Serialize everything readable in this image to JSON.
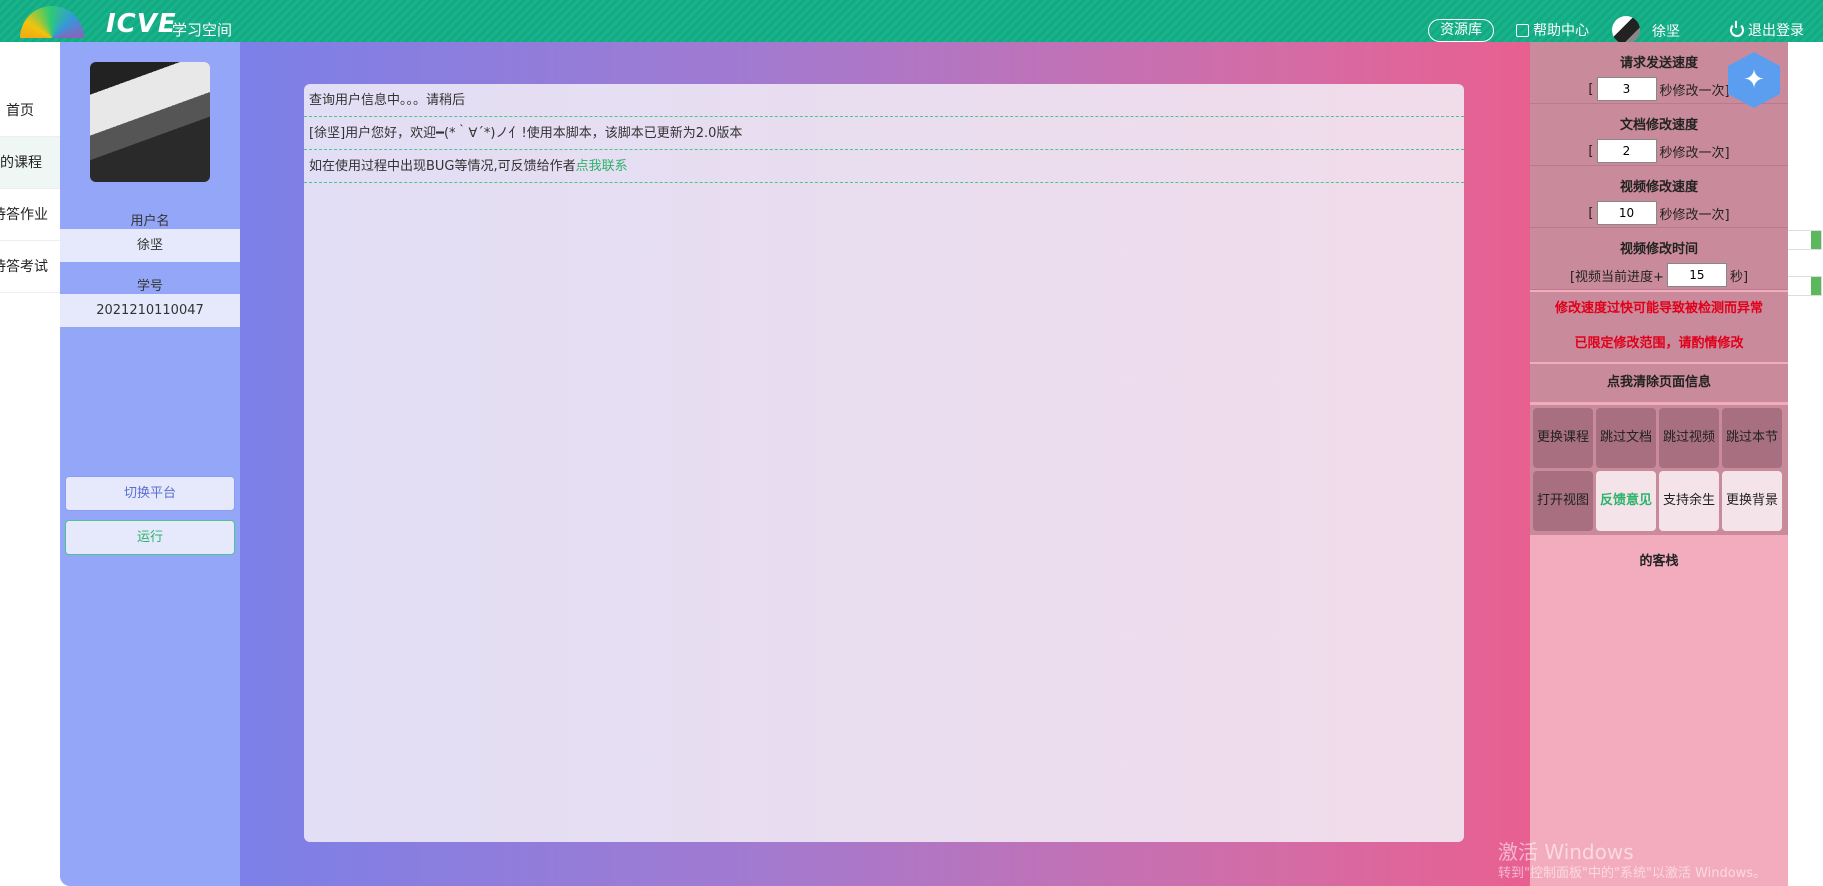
{
  "topbar": {
    "logo_text": "ICVE",
    "logo_sub": "学习空间",
    "resource": "资源库",
    "help": "帮助中心",
    "username": "徐坚",
    "logout": "退出登录"
  },
  "bg_nav": [
    "首页",
    "我的课程",
    "待答作业",
    "待答考试"
  ],
  "panel_left": {
    "username_label": "用户名",
    "username": "徐坚",
    "id_label": "学号",
    "id": "2021210110047",
    "switch_btn": "切换平台",
    "run_btn": "运行"
  },
  "log": {
    "lines": [
      "查询用户信息中。。。请稍后",
      "[徐坚]用户您好，欢迎━(*｀∀´*)ノ亻!使用本脚本，该脚本已更新为2.0版本",
      "如在使用过程中出现BUG等情况,可反馈给作者"
    ],
    "link": "点我联系"
  },
  "settings": {
    "req_title": "请求发送速度",
    "req_value": "3",
    "doc_title": "文档修改速度",
    "doc_value": "2",
    "vid_title": "视频修改速度",
    "vid_value": "10",
    "suffix": "秒修改一次]",
    "prefix": "[",
    "time_title": "视频修改时间",
    "time_prefix": "[视频当前进度+",
    "time_value": "15",
    "time_suffix": "秒]",
    "warn1": "修改速度过快可能导致被检测而异常",
    "warn2": "已限定修改范围，请酌情修改",
    "clear": "点我清除页面信息"
  },
  "grid": [
    "更换课程",
    "跳过文档",
    "跳过视频",
    "跳过本节",
    "打开视图",
    "反馈意见",
    "支持余生",
    "更换背景"
  ],
  "footer_text": "的客栈",
  "watermark": {
    "line1": "激活 Windows",
    "line2": "转到\"控制面板\"中的\"系统\"以激活 Windows。"
  }
}
